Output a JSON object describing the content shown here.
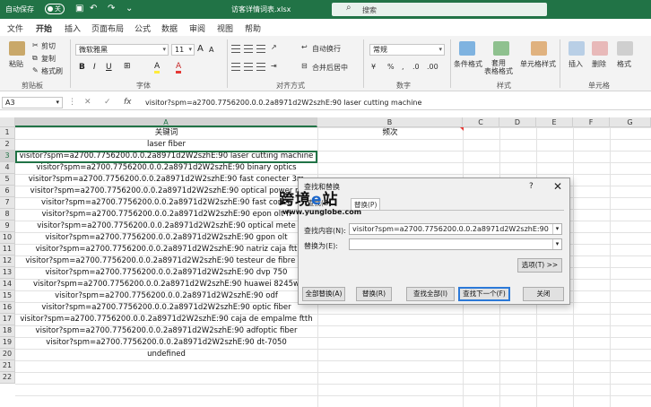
{
  "titlebar": {
    "autosave_label": "自动保存",
    "autosave_state": "关",
    "document_title": "访客详情词表.xlsx",
    "search_placeholder": "搜索"
  },
  "tabs": [
    "文件",
    "开始",
    "插入",
    "页面布局",
    "公式",
    "数据",
    "审阅",
    "视图",
    "帮助"
  ],
  "ribbon": {
    "clipboard": {
      "paste": "粘贴",
      "cut": "剪切",
      "copy": "复制",
      "format_painter": "格式刷",
      "label": "剪贴板"
    },
    "font": {
      "name": "微软雅黑",
      "size": "11",
      "label": "字体",
      "grow": "A",
      "shrink": "A",
      "bold": "B",
      "italic": "I",
      "underline": "U",
      "font_color_glyph": "A",
      "highlight_glyph": "A"
    },
    "alignment": {
      "wrap": "自动换行",
      "merge": "合并后居中",
      "label": "对齐方式"
    },
    "number": {
      "format": "常规",
      "label": "数字"
    },
    "styles": {
      "conditional": "条件格式",
      "table": "套用\n表格格式",
      "cell_styles": "单元格样式",
      "label": "样式"
    },
    "cells": {
      "insert": "插入",
      "delete": "删除",
      "format": "格式",
      "label": "单元格"
    }
  },
  "formula_bar": {
    "name_box": "A3",
    "value": "visitor?spm=a2700.7756200.0.0.2a8971d2W2szhE:90 laser cutting machine"
  },
  "columns": [
    "A",
    "B",
    "C",
    "D",
    "E",
    "F",
    "G"
  ],
  "rows": [
    "1",
    "2",
    "3",
    "4",
    "5",
    "6",
    "7",
    "8",
    "9",
    "10",
    "11",
    "12",
    "13",
    "14",
    "15",
    "16",
    "17",
    "18",
    "19",
    "20",
    "21",
    "22"
  ],
  "cells": {
    "A1": "关键词",
    "B1": "频次",
    "A2": "laser fiber",
    "A3": "visitor?spm=a2700.7756200.0.0.2a8971d2W2szhE:90 laser cutting machine",
    "A4": "visitor?spm=a2700.7756200.0.0.2a8971d2W2szhE:90 binary optics",
    "A5": "visitor?spm=a2700.7756200.0.0.2a8971d2W2szhE:90 fast conecter 3m",
    "A6": "visitor?spm=a2700.7756200.0.0.2a8971d2W2szhE:90 optical power m",
    "A7": "visitor?spm=a2700.7756200.0.0.2a8971d2W2szhE:90 fast conec",
    "A8": "visitor?spm=a2700.7756200.0.0.2a8971d2W2szhE:90 epon olt fi",
    "A9": "visitor?spm=a2700.7756200.0.0.2a8971d2W2szhE:90 optical  mete",
    "A10": "visitor?spm=a2700.7756200.0.0.2a8971d2W2szhE:90 gpon olt",
    "A11": "visitor?spm=a2700.7756200.0.0.2a8971d2W2szhE:90 natriz caja ftt",
    "A12": "visitor?spm=a2700.7756200.0.0.2a8971d2W2szhE:90 testeur de fibre op",
    "A13": "visitor?spm=a2700.7756200.0.0.2a8971d2W2szhE:90 dvp 750",
    "A14": "visitor?spm=a2700.7756200.0.0.2a8971d2W2szhE:90 huawei 8245w",
    "A15": "visitor?spm=a2700.7756200.0.0.2a8971d2W2szhE:90 odf",
    "A16": "visitor?spm=a2700.7756200.0.0.2a8971d2W2szhE:90 optic fiber",
    "A17": "visitor?spm=a2700.7756200.0.0.2a8971d2W2szhE:90 caja de empalme ftth",
    "A18": "visitor?spm=a2700.7756200.0.0.2a8971d2W2szhE:90 adfoptic fiber",
    "A19": "visitor?spm=a2700.7756200.0.0.2a8971d2W2szhE:90 dt-7050",
    "A20": "undefined"
  },
  "watermark": {
    "logo_a": "跨境",
    "logo_e": "e",
    "logo_b": "站",
    "url": "www.yunglobe.com"
  },
  "dialog": {
    "title": "查找和替换",
    "help": "?",
    "close": "✕",
    "tab_find": "查找(D)",
    "tab_replace": "替换(P)",
    "find_label": "查找内容(N):",
    "find_value": "visitor?spm=a2700.7756200.0.0.2a8971d2W2szhE:90",
    "replace_label": "替换为(E):",
    "replace_value": "",
    "options_btn": "选项(T) >>",
    "replace_all_btn": "全部替换(A)",
    "replace_btn": "替换(R)",
    "find_all_btn": "查找全部(I)",
    "find_next_btn": "查找下一个(F)",
    "close_btn": "关闭"
  },
  "colors": {
    "excel_green": "#217346",
    "dialog_focus": "#2b79d8"
  }
}
